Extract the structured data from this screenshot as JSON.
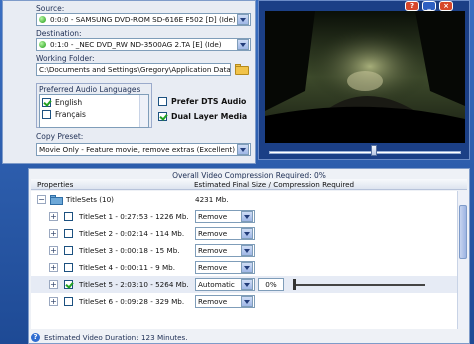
{
  "source": {
    "label": "Source:",
    "value": "0:0:0 - SAMSUNG DVD-ROM SD-616E F502 [D] (Ide)"
  },
  "destination": {
    "label": "Destination:",
    "value": "0:1:0 - _NEC DVD_RW ND-3500AG 2.TA [E] (Ide)"
  },
  "working_folder": {
    "label": "Working Folder:",
    "value": "C:\\Documents and Settings\\Gregory\\Application Data\\"
  },
  "languages": {
    "title": "Preferred Audio Languages",
    "items": [
      {
        "label": "English",
        "checked": true
      },
      {
        "label": "Français",
        "checked": false
      }
    ]
  },
  "options": {
    "prefer_dts": {
      "label": "Prefer DTS Audio",
      "checked": false
    },
    "dual_layer": {
      "label": "Dual Layer Media",
      "checked": true
    }
  },
  "copy_preset": {
    "label": "Copy Preset:",
    "value": "Movie Only - Feature movie, remove extras (Excellent)"
  },
  "player": {
    "slider_position": 0.55
  },
  "compression": {
    "overall": "Overall Video Compression Required: 0%",
    "col_properties": "Properties",
    "col_estimated": "Estimated Final Size / Compression Required",
    "root": {
      "label": "TitleSets (10)",
      "size": "4231 Mb."
    },
    "titlesets": [
      {
        "label": "TitleSet 1 - 0:27:53 - 1226 Mb.",
        "action": "Remove",
        "checked": false
      },
      {
        "label": "TitleSet 2 - 0:02:14 - 114 Mb.",
        "action": "Remove",
        "checked": false
      },
      {
        "label": "TitleSet 3 - 0:00:18 - 15 Mb.",
        "action": "Remove",
        "checked": false
      },
      {
        "label": "TitleSet 4 - 0:00:11 - 9 Mb.",
        "action": "Remove",
        "checked": false
      },
      {
        "label": "TitleSet 5 - 2:03:10 - 5264 Mb.",
        "action": "Automatic",
        "checked": true,
        "percent": "0%"
      },
      {
        "label": "TitleSet 6 - 0:09:28 - 329 Mb.",
        "action": "Remove",
        "checked": false
      }
    ],
    "status": "Estimated Video Duration: 123 Minutes."
  }
}
